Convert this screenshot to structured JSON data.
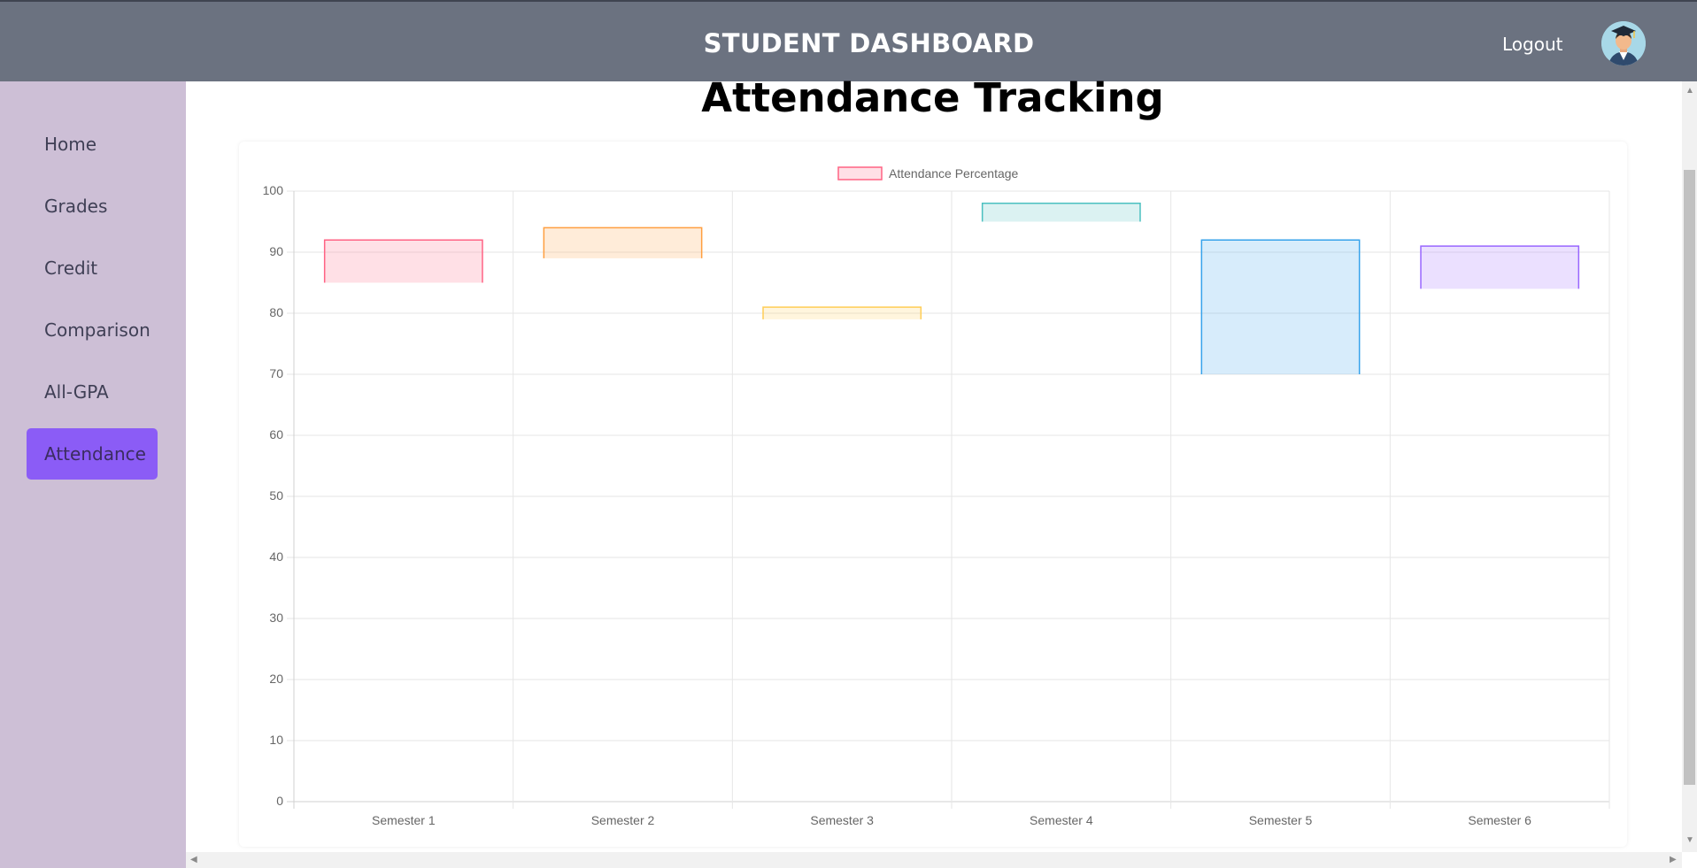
{
  "header": {
    "title": "STUDENT DASHBOARD",
    "logout_label": "Logout",
    "avatar_icon": "graduate-avatar-icon"
  },
  "sidebar": {
    "items": [
      {
        "label": "Home",
        "active": false
      },
      {
        "label": "Grades",
        "active": false
      },
      {
        "label": "Credit",
        "active": false
      },
      {
        "label": "Comparison",
        "active": false
      },
      {
        "label": "All-GPA",
        "active": false
      },
      {
        "label": "Attendance",
        "active": true
      }
    ]
  },
  "main": {
    "title": "Attendance Tracking"
  },
  "colors": {
    "header_bg": "#6b7280",
    "sidebar_bg": "#cdbfd6",
    "active_item_bg": "#8b5cf6"
  },
  "chart_data": {
    "type": "bar",
    "title": "",
    "xlabel": "",
    "ylabel": "",
    "legend": {
      "position": "top",
      "entries": [
        "Attendance Percentage"
      ]
    },
    "categories": [
      "Semester 1",
      "Semester 2",
      "Semester 3",
      "Semester 4",
      "Semester 5",
      "Semester 6"
    ],
    "series": [
      {
        "name": "Attendance Percentage",
        "ranges": [
          [
            85,
            92
          ],
          [
            89,
            94
          ],
          [
            79,
            81
          ],
          [
            95,
            98
          ],
          [
            70,
            92
          ],
          [
            84,
            91
          ]
        ]
      }
    ],
    "colors": [
      {
        "fill": "rgba(255,99,132,0.2)",
        "stroke": "#ff6384"
      },
      {
        "fill": "rgba(255,159,64,0.2)",
        "stroke": "#ff9f40"
      },
      {
        "fill": "rgba(255,205,86,0.2)",
        "stroke": "#ffcd56"
      },
      {
        "fill": "rgba(75,192,192,0.2)",
        "stroke": "#4bc0c0"
      },
      {
        "fill": "rgba(54,162,235,0.2)",
        "stroke": "#36a2eb"
      },
      {
        "fill": "rgba(153,102,255,0.2)",
        "stroke": "#9966ff"
      }
    ],
    "y_ticks": [
      "0",
      "10",
      "20",
      "30",
      "40",
      "50",
      "60",
      "70",
      "80",
      "90",
      "100"
    ],
    "ylim": [
      0,
      100
    ],
    "grid": true
  }
}
